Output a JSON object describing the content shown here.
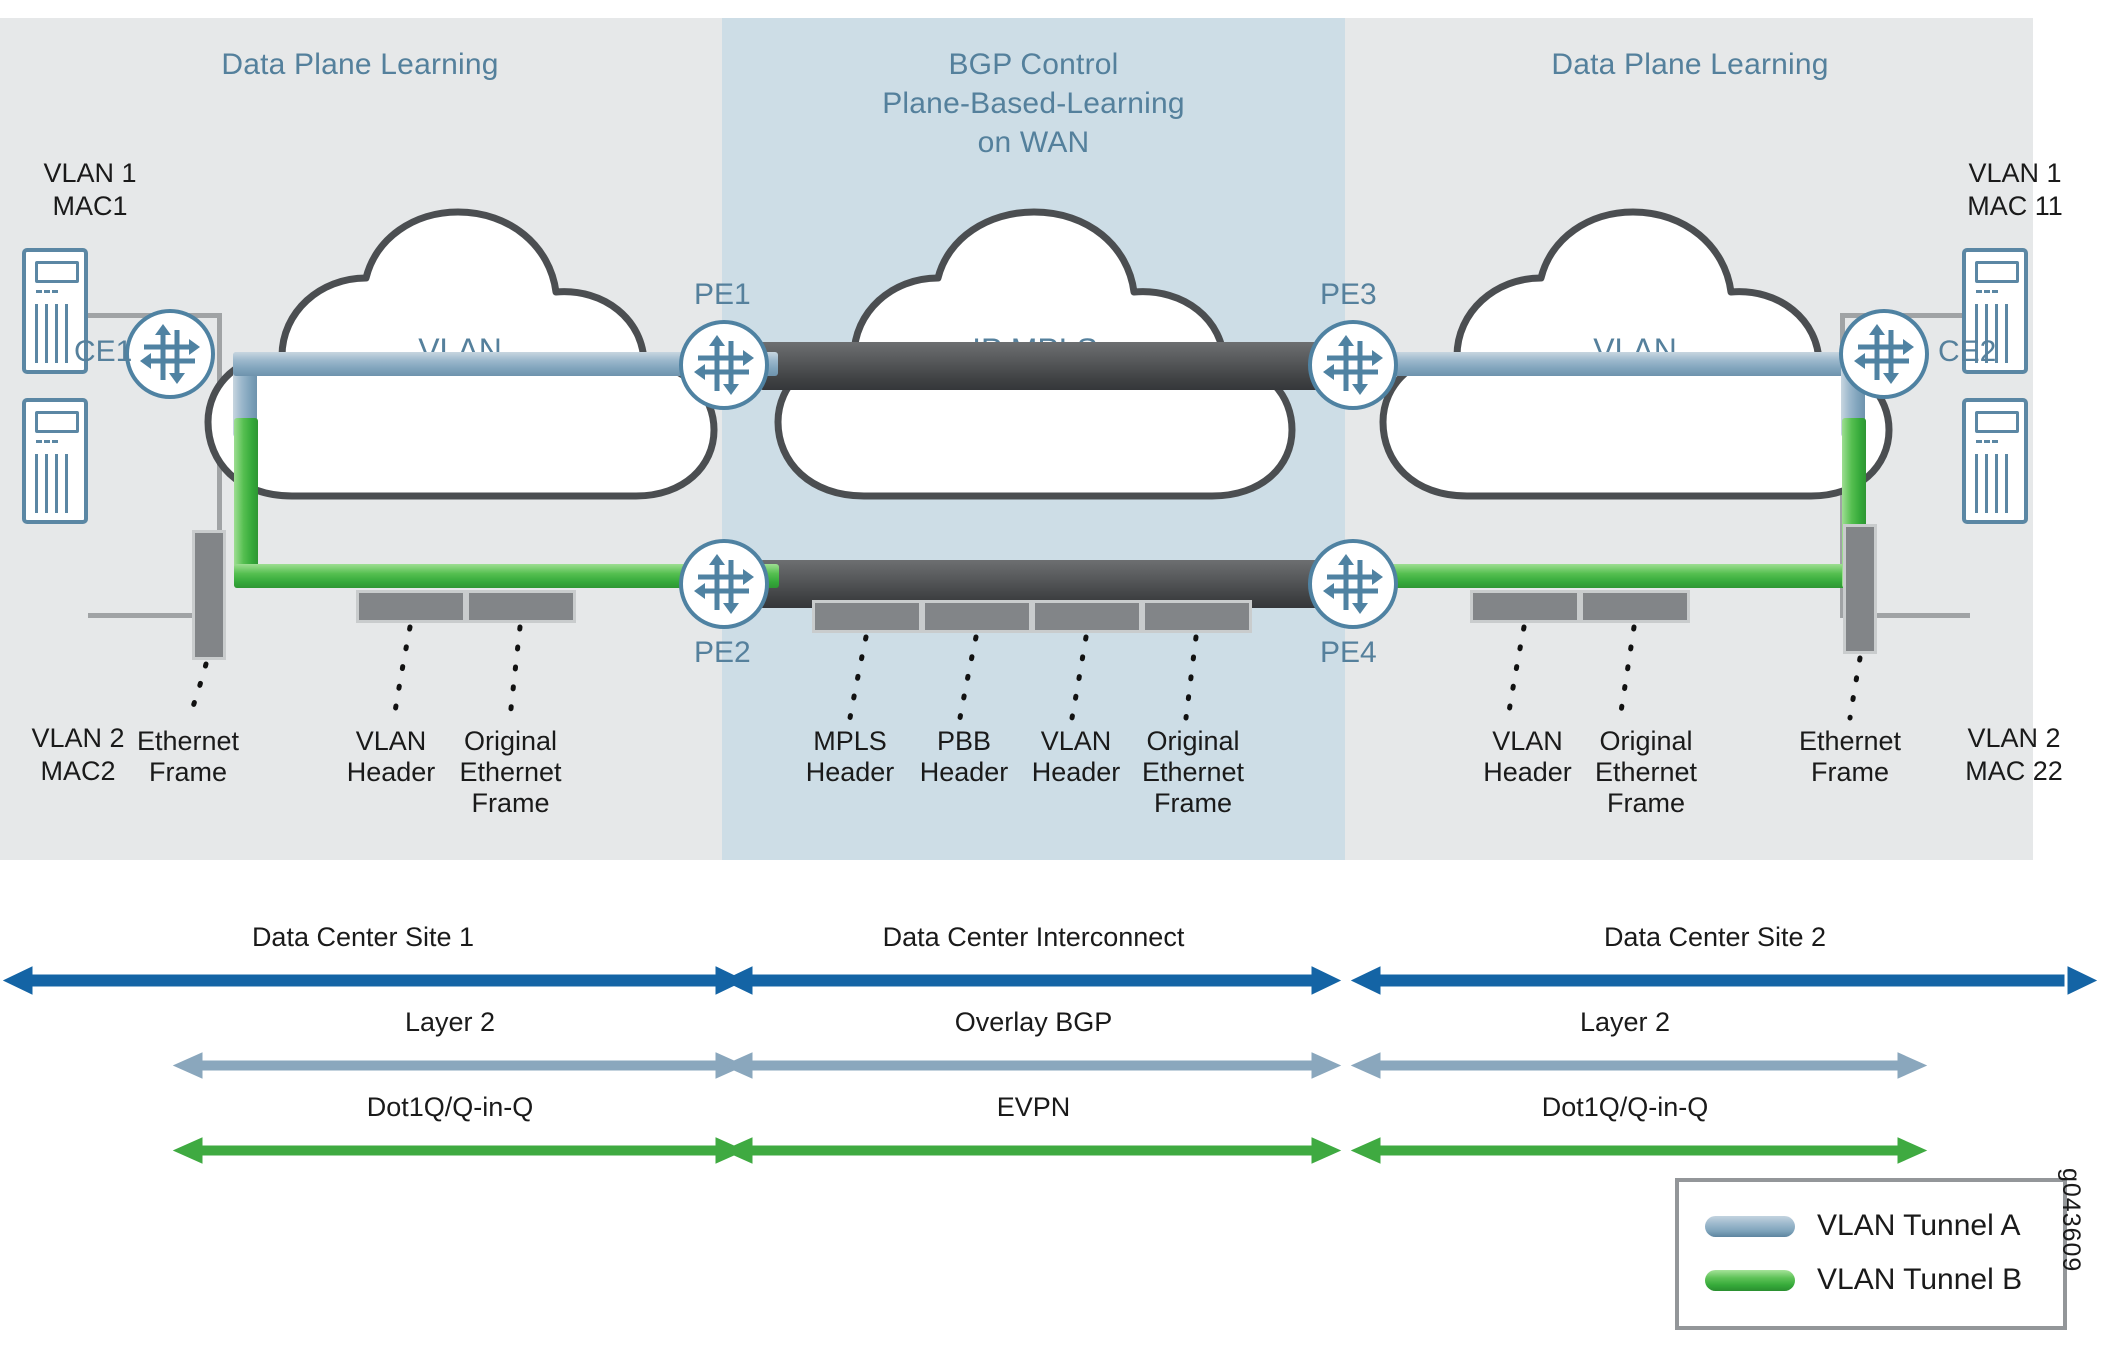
{
  "zones": {
    "left": {
      "title": "Data Plane Learning"
    },
    "center": {
      "title": "BGP Control\nPlane-Based-Learning\non WAN"
    },
    "right": {
      "title": "Data Plane Learning"
    }
  },
  "endpoints": {
    "left_top": "VLAN 1\nMAC1",
    "left_bottom": "VLAN 2\nMAC2",
    "right_top": "VLAN 1\nMAC 11",
    "right_bottom": "VLAN 2\nMAC 22"
  },
  "clouds": {
    "left": "VLAN",
    "center": "IP MPLS",
    "right": "VLAN"
  },
  "routers": {
    "ce1": "CE1",
    "ce2": "CE2",
    "pe1": "PE1",
    "pe2": "PE2",
    "pe3": "PE3",
    "pe4": "PE4"
  },
  "frame_labels": {
    "left": [
      "Ethernet\nFrame",
      "VLAN\nHeader",
      "Original\nEthernet\nFrame"
    ],
    "center": [
      "MPLS\nHeader",
      "PBB\nHeader",
      "VLAN\nHeader",
      "Original\nEthernet\nFrame"
    ],
    "right": [
      "VLAN\nHeader",
      "Original\nEthernet\nFrame",
      "Ethernet\nFrame"
    ]
  },
  "arrow_rows": [
    {
      "name": "scope",
      "color": "#1464a5",
      "segments": [
        {
          "label": "Data Center Site 1"
        },
        {
          "label": "Data Center Interconnect"
        },
        {
          "label": "Data Center Site 2"
        }
      ]
    },
    {
      "name": "protocol-layer",
      "color": "#8aa7bd",
      "segments": [
        {
          "label": "Layer 2"
        },
        {
          "label": "Overlay BGP"
        },
        {
          "label": "Layer 2"
        }
      ]
    },
    {
      "name": "encapsulation",
      "color": "#3faa41",
      "segments": [
        {
          "label": "Dot1Q/Q-in-Q"
        },
        {
          "label": "EVPN"
        },
        {
          "label": "Dot1Q/Q-in-Q"
        }
      ]
    }
  ],
  "legend": {
    "items": [
      {
        "label": "VLAN Tunnel A",
        "color": "#7ea3bb"
      },
      {
        "label": "VLAN Tunnel B",
        "color": "#3faa41"
      }
    ]
  },
  "watermark": "g043609"
}
